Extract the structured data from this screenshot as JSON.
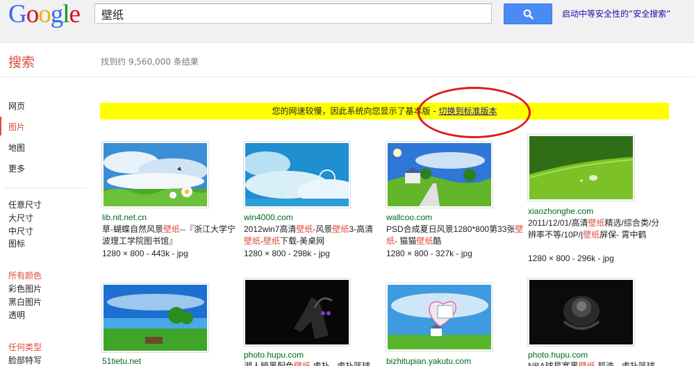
{
  "header": {
    "logo_letters": [
      {
        "ch": "G",
        "color": "#3369e8"
      },
      {
        "ch": "o",
        "color": "#d50f25"
      },
      {
        "ch": "o",
        "color": "#eeb211"
      },
      {
        "ch": "g",
        "color": "#3369e8"
      },
      {
        "ch": "l",
        "color": "#009925"
      },
      {
        "ch": "e",
        "color": "#d50f25"
      }
    ],
    "search_value": "壁纸",
    "search_button_icon": "search-icon",
    "safe_search_link": "启动中等安全性的“安全搜索”"
  },
  "subheader": {
    "search_label": "搜索",
    "result_stats": "找到约 9,560,000 条结果"
  },
  "sidebar": {
    "types": [
      "网页",
      "图片",
      "地图",
      "更多"
    ],
    "active_type": "图片",
    "sizes": [
      "任意尺寸",
      "大尺寸",
      "中尺寸",
      "图标"
    ],
    "colors_heading": "所有颜色",
    "colors": [
      "彩色图片",
      "黑白图片",
      "透明"
    ],
    "type_heading": "任何类型",
    "type_items": [
      "脸部特写"
    ]
  },
  "notice": {
    "text": "您的网速较慢，因此系统向您显示了基本版 - ",
    "link": "切换到标准版本"
  },
  "results": [
    {
      "domain": "lib.nit.net.cn",
      "title_parts": [
        [
          "草-蝴蝶自然风景",
          false
        ],
        [
          "壁纸",
          true
        ],
        [
          "--『浙江大学宁波理工学院图书馆』",
          false
        ]
      ],
      "meta": "1280 × 800 - 443k - jpg"
    },
    {
      "domain": "win4000.com",
      "title_parts": [
        [
          "2012win7高清",
          false
        ],
        [
          "壁纸",
          true
        ],
        [
          "-风景",
          false
        ],
        [
          "壁纸",
          true
        ],
        [
          "3-高清",
          false
        ],
        [
          "壁纸",
          true
        ],
        [
          "-",
          false
        ],
        [
          "壁纸",
          true
        ],
        [
          "下载-美桌网",
          false
        ]
      ],
      "meta": "1280 × 800 - 298k - jpg"
    },
    {
      "domain": "wallcoo.com",
      "title_parts": [
        [
          "PSD合成夏日风景1280*800第33张",
          false
        ],
        [
          "壁纸",
          true
        ],
        [
          "- 猫猫",
          false
        ],
        [
          "壁纸",
          true
        ],
        [
          "酷",
          false
        ]
      ],
      "meta": "1280 × 800 - 327k - jpg"
    },
    {
      "domain": "xiaozhonghe.com",
      "title_parts": [
        [
          "2011/12/01/高清",
          false
        ],
        [
          "壁纸",
          true
        ],
        [
          "精选/综合类/分辨率不等/10P/|",
          false
        ],
        [
          "壁纸",
          true
        ],
        [
          "屏保- 霄中鹤",
          false
        ]
      ],
      "meta": "1280 × 800 - 296k - jpg"
    },
    {
      "domain": "51tietu.net",
      "title_parts": [],
      "meta": ""
    },
    {
      "domain": "photo.hupu.com",
      "title_parts": [
        [
          "湖人暗黑配色",
          false
        ],
        [
          "壁纸",
          true
        ],
        [
          " 虎扑 - 虎扑篮球",
          false
        ]
      ],
      "meta": ""
    },
    {
      "domain": "bizhitupian.yakutu.com",
      "title_parts": [],
      "meta": ""
    },
    {
      "domain": "photo.hupu.com",
      "title_parts": [
        [
          "NBA球星寒黑",
          false
        ],
        [
          "壁纸",
          true
        ],
        [
          " 邦浩 - 虎扑篮球",
          false
        ]
      ],
      "meta": ""
    }
  ]
}
